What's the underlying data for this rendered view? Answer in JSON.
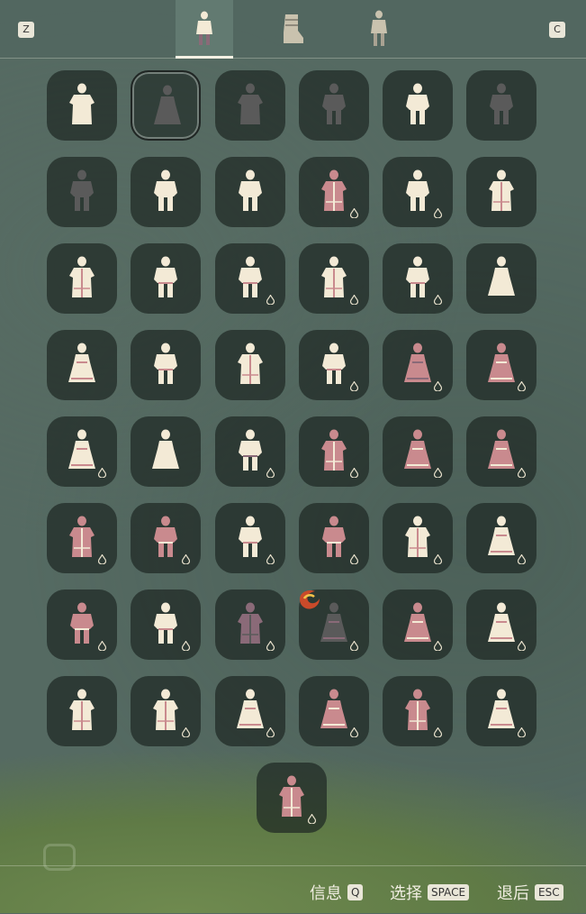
{
  "topbar": {
    "left_key": "Z",
    "right_key": "C",
    "tabs": [
      {
        "name": "outfit",
        "icon": "outfit-icon",
        "active": true
      },
      {
        "name": "shoes",
        "icon": "boot-icon",
        "active": false
      },
      {
        "name": "full-body",
        "icon": "body-icon",
        "active": false
      }
    ]
  },
  "colors": {
    "cream": "#f3ead6",
    "dark_gray": "#5a5a5a",
    "rose": "#c98a8e",
    "mauve": "#8a6a78",
    "slot_bg": "#26302c",
    "accent_red": "#c94a2a"
  },
  "outfits": [
    {
      "shape": "robe",
      "color": "cream",
      "accent": "cream",
      "drop": false
    },
    {
      "shape": "dress",
      "color": "dark_gray",
      "accent": "dark_gray",
      "drop": false,
      "selected": true
    },
    {
      "shape": "robe",
      "color": "dark_gray",
      "accent": "dark_gray",
      "drop": false
    },
    {
      "shape": "pants",
      "color": "dark_gray",
      "accent": "dark_gray",
      "drop": false
    },
    {
      "shape": "pants",
      "color": "cream",
      "accent": "cream",
      "drop": false
    },
    {
      "shape": "pants",
      "color": "dark_gray",
      "accent": "dark_gray",
      "drop": false
    },
    {
      "shape": "pants",
      "color": "dark_gray",
      "accent": "dark_gray",
      "drop": false
    },
    {
      "shape": "pants",
      "color": "cream",
      "accent": "cream",
      "drop": false
    },
    {
      "shape": "pants",
      "color": "cream",
      "accent": "cream",
      "drop": false
    },
    {
      "shape": "robe",
      "color": "rose",
      "accent": "cream",
      "drop": true
    },
    {
      "shape": "pants",
      "color": "cream",
      "accent": "cream",
      "drop": true
    },
    {
      "shape": "robe",
      "color": "cream",
      "accent": "rose",
      "drop": false
    },
    {
      "shape": "robe",
      "color": "cream",
      "accent": "rose",
      "drop": false
    },
    {
      "shape": "pants",
      "color": "cream",
      "accent": "rose",
      "drop": false
    },
    {
      "shape": "pants",
      "color": "cream",
      "accent": "rose",
      "drop": true
    },
    {
      "shape": "robe",
      "color": "cream",
      "accent": "rose",
      "drop": true
    },
    {
      "shape": "pants",
      "color": "cream",
      "accent": "rose",
      "drop": true
    },
    {
      "shape": "dress",
      "color": "cream",
      "accent": "cream",
      "drop": false
    },
    {
      "shape": "dress",
      "color": "cream",
      "accent": "rose",
      "drop": false
    },
    {
      "shape": "pants",
      "color": "cream",
      "accent": "rose",
      "drop": false
    },
    {
      "shape": "robe",
      "color": "cream",
      "accent": "rose",
      "drop": false
    },
    {
      "shape": "pants",
      "color": "cream",
      "accent": "rose",
      "drop": true
    },
    {
      "shape": "dress",
      "color": "rose",
      "accent": "mauve",
      "drop": true
    },
    {
      "shape": "dress",
      "color": "rose",
      "accent": "cream",
      "drop": true
    },
    {
      "shape": "dress",
      "color": "cream",
      "accent": "rose",
      "drop": true
    },
    {
      "shape": "dress",
      "color": "cream",
      "accent": "cream",
      "drop": false
    },
    {
      "shape": "pants",
      "color": "cream",
      "accent": "mauve",
      "drop": true
    },
    {
      "shape": "robe",
      "color": "rose",
      "accent": "cream",
      "drop": true
    },
    {
      "shape": "dress",
      "color": "rose",
      "accent": "cream",
      "drop": true
    },
    {
      "shape": "dress",
      "color": "rose",
      "accent": "cream",
      "drop": true
    },
    {
      "shape": "robe",
      "color": "rose",
      "accent": "cream",
      "drop": true
    },
    {
      "shape": "pants",
      "color": "rose",
      "accent": "cream",
      "drop": true
    },
    {
      "shape": "pants",
      "color": "cream",
      "accent": "rose",
      "drop": true
    },
    {
      "shape": "pants",
      "color": "rose",
      "accent": "cream",
      "drop": true
    },
    {
      "shape": "robe",
      "color": "cream",
      "accent": "rose",
      "drop": true
    },
    {
      "shape": "dress",
      "color": "cream",
      "accent": "rose",
      "drop": true
    },
    {
      "shape": "pants",
      "color": "rose",
      "accent": "cream",
      "drop": true
    },
    {
      "shape": "pants",
      "color": "cream",
      "accent": "rose",
      "drop": true
    },
    {
      "shape": "robe",
      "color": "mauve",
      "accent": "dark_gray",
      "drop": true
    },
    {
      "shape": "dress",
      "color": "dark_gray",
      "accent": "mauve",
      "drop": true,
      "badge": true
    },
    {
      "shape": "dress",
      "color": "rose",
      "accent": "cream",
      "drop": true
    },
    {
      "shape": "dress",
      "color": "cream",
      "accent": "rose",
      "drop": true
    },
    {
      "shape": "robe",
      "color": "cream",
      "accent": "rose",
      "drop": false
    },
    {
      "shape": "robe",
      "color": "cream",
      "accent": "rose",
      "drop": true
    },
    {
      "shape": "dress",
      "color": "cream",
      "accent": "rose",
      "drop": true
    },
    {
      "shape": "dress",
      "color": "rose",
      "accent": "cream",
      "drop": true
    },
    {
      "shape": "robe",
      "color": "rose",
      "accent": "cream",
      "drop": true
    },
    {
      "shape": "dress",
      "color": "cream",
      "accent": "rose",
      "drop": true
    },
    {
      "shape": "robe",
      "color": "rose",
      "accent": "cream",
      "drop": true
    }
  ],
  "bottombar": {
    "hints": [
      {
        "label": "信息",
        "key": "Q"
      },
      {
        "label": "选择",
        "key": "SPACE"
      },
      {
        "label": "退后",
        "key": "ESC"
      }
    ]
  }
}
